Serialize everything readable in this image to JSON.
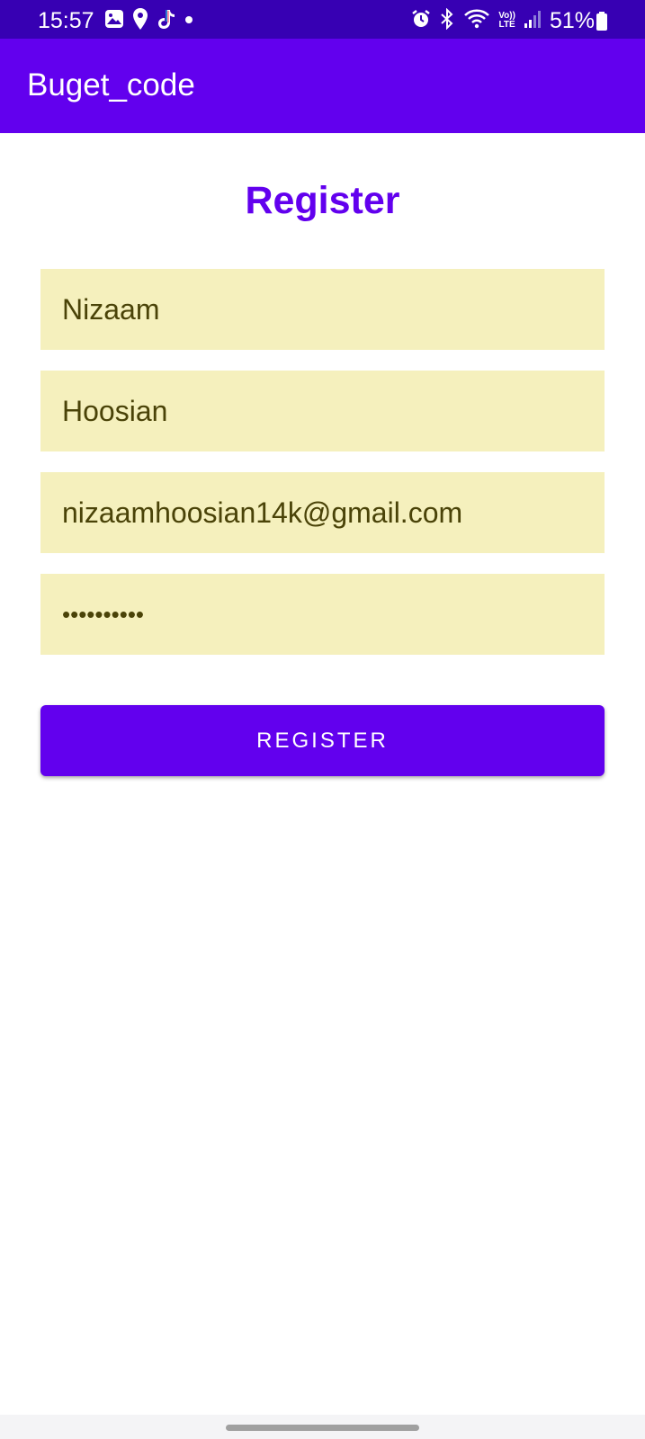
{
  "status_bar": {
    "time": "15:57",
    "battery_percent": "51%",
    "left_icons": [
      "gallery-icon",
      "location-pin-icon",
      "tiktok-icon",
      "dot-icon"
    ],
    "right_icons": [
      "alarm-icon",
      "bluetooth-icon",
      "wifi-icon",
      "volte-icon",
      "signal-icon",
      "battery-icon"
    ],
    "volte_label_top": "Vo))",
    "volte_label_bottom": "LTE"
  },
  "app_bar": {
    "title": "Buget_code"
  },
  "form": {
    "heading": "Register",
    "first_name": "Nizaam",
    "last_name": "Hoosian",
    "email": "nizaamhoosian14k@gmail.com",
    "password_masked": "••••••••••",
    "submit_label": "REGISTER"
  },
  "colors": {
    "status_bar": "#3700b3",
    "app_bar": "#6200ee",
    "accent": "#6200ee",
    "field_bg": "#f5f0bd",
    "field_text": "#4a4308"
  }
}
